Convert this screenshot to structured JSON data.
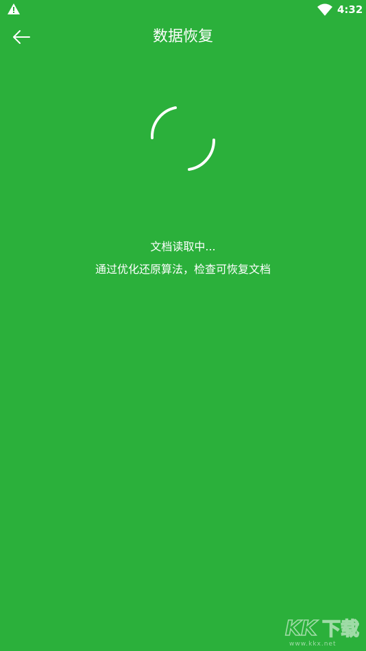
{
  "status_bar": {
    "time": "4:32",
    "left_icon": "warning-icon",
    "right_icon": "wifi-icon"
  },
  "app_bar": {
    "title": "数据恢复",
    "back_icon": "arrow-left-icon"
  },
  "content": {
    "status": "文档读取中...",
    "description": "通过优化还原算法，检查可恢复文档"
  },
  "watermark": {
    "logo_text": "KK下载",
    "url": "www.kkx.net"
  },
  "colors": {
    "background": "#2bb03b",
    "foreground": "#ffffff"
  }
}
